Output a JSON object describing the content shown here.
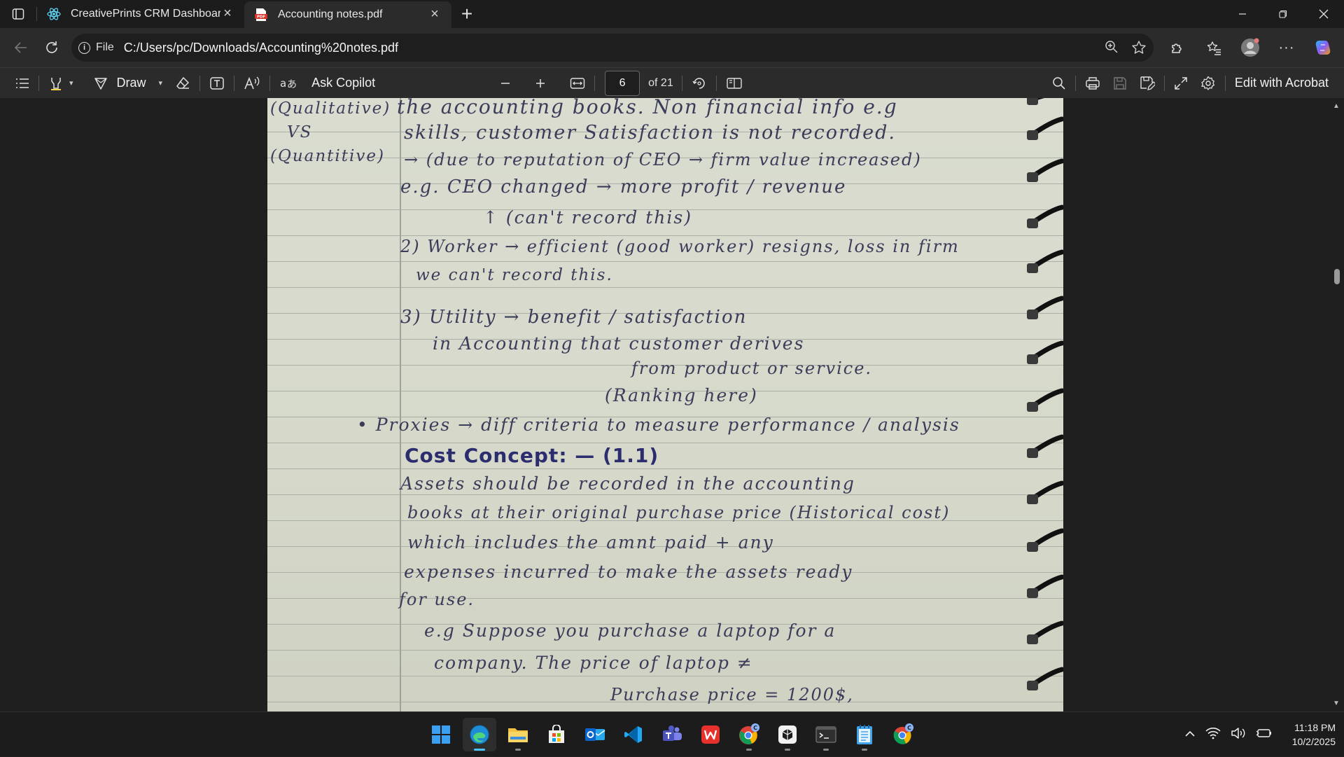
{
  "tabs": [
    {
      "title": "CreativePrints CRM Dashboard",
      "icon": "react-icon",
      "active": false
    },
    {
      "title": "Accounting notes.pdf",
      "icon": "pdf-icon",
      "active": true
    }
  ],
  "address": {
    "scheme_label": "File",
    "url": "C:/Users/pc/Downloads/Accounting%20notes.pdf"
  },
  "pdf_toolbar": {
    "draw_label": "Draw",
    "ask_copilot_label": "Ask Copilot",
    "current_page": "6",
    "page_total": "of 21",
    "edit_label": "Edit with Acrobat"
  },
  "notes": {
    "margin_lines": [
      "(Qualitative)",
      "VS",
      "(Quantitive)"
    ],
    "lines": [
      "the accounting books. Non financial info e.g",
      "skills, customer Satisfaction is not recorded.",
      "→ (due to reputation of CEO → firm value increased)",
      "e.g. CEO changed → more profit / revenue",
      "↑ (can't record this)",
      "2) Worker → efficient (good worker) resigns, loss in firm",
      "we can't record this.",
      "3) Utility        → benefit / satisfaction",
      "in Accounting       that customer derives",
      "from product or service.",
      "(Ranking here)",
      "• Proxies → diff criteria to measure performance / analysis",
      "Cost Concept: — (1.1)",
      "Assets should be recorded in the accounting",
      "books at their original purchase price (Historical cost)",
      "which includes the amnt paid + any",
      "expenses incurred to make the assets ready",
      "for use.",
      "e.g Suppose you purchase a laptop for a",
      "company. The price of laptop ≠",
      "Purchase price = 1200$,"
    ]
  },
  "taskbar": {
    "apps": [
      "start-icon",
      "edge-icon",
      "file-explorer-icon",
      "store-icon",
      "outlook-icon",
      "vscode-icon",
      "teams-icon",
      "wps-icon",
      "chrome-profile-icon",
      "app-icon",
      "terminal-icon",
      "notepad-icon",
      "chrome-icon"
    ],
    "time": "11:18 PM",
    "date": "10/2/2025"
  }
}
